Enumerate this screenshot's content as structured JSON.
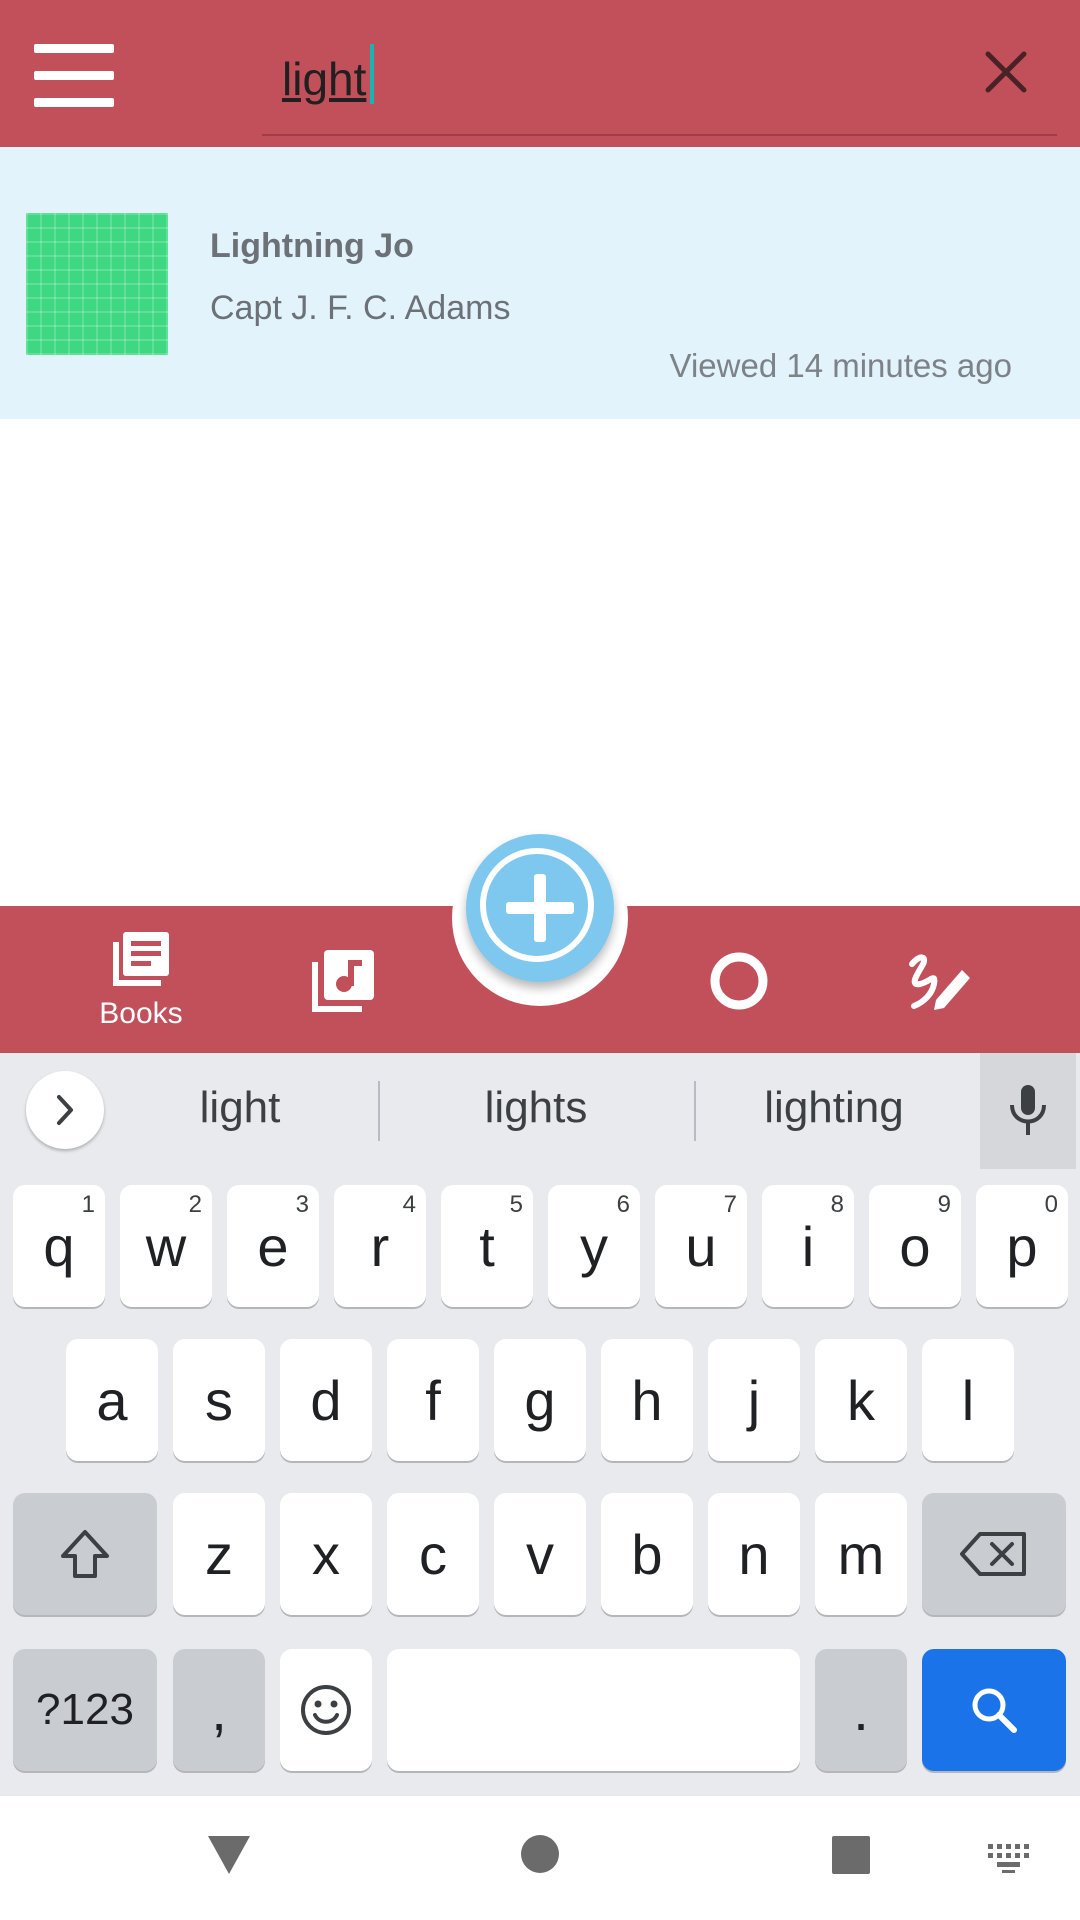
{
  "app_bar": {
    "search_value": "light",
    "icons": {
      "menu": "hamburger-menu-icon",
      "clear": "close-icon"
    }
  },
  "results": [
    {
      "title": "Lightning Jo",
      "author": "Capt J. F. C. Adams",
      "meta": "Viewed 14 minutes ago",
      "thumbnail_color": "#3ed882"
    }
  ],
  "bottom_nav": {
    "books_label": "Books",
    "items": [
      "books-icon",
      "music-library-icon",
      "add-fab",
      "circle-icon",
      "draw-icon"
    ]
  },
  "keyboard": {
    "suggestions": [
      "light",
      "lights",
      "lighting"
    ],
    "row1": [
      {
        "key": "q",
        "hint": "1"
      },
      {
        "key": "w",
        "hint": "2"
      },
      {
        "key": "e",
        "hint": "3"
      },
      {
        "key": "r",
        "hint": "4"
      },
      {
        "key": "t",
        "hint": "5"
      },
      {
        "key": "y",
        "hint": "6"
      },
      {
        "key": "u",
        "hint": "7"
      },
      {
        "key": "i",
        "hint": "8"
      },
      {
        "key": "o",
        "hint": "9"
      },
      {
        "key": "p",
        "hint": "0"
      }
    ],
    "row2": [
      "a",
      "s",
      "d",
      "f",
      "g",
      "h",
      "j",
      "k",
      "l"
    ],
    "row3": [
      "z",
      "x",
      "c",
      "v",
      "b",
      "n",
      "m"
    ],
    "symbols_label": "?123",
    "comma_label": ",",
    "period_label": "."
  },
  "colors": {
    "brand": "#c1505a",
    "result_bg": "#e3f3fb",
    "fab": "#7ec8ef",
    "keyboard_action": "#1a73e8"
  }
}
